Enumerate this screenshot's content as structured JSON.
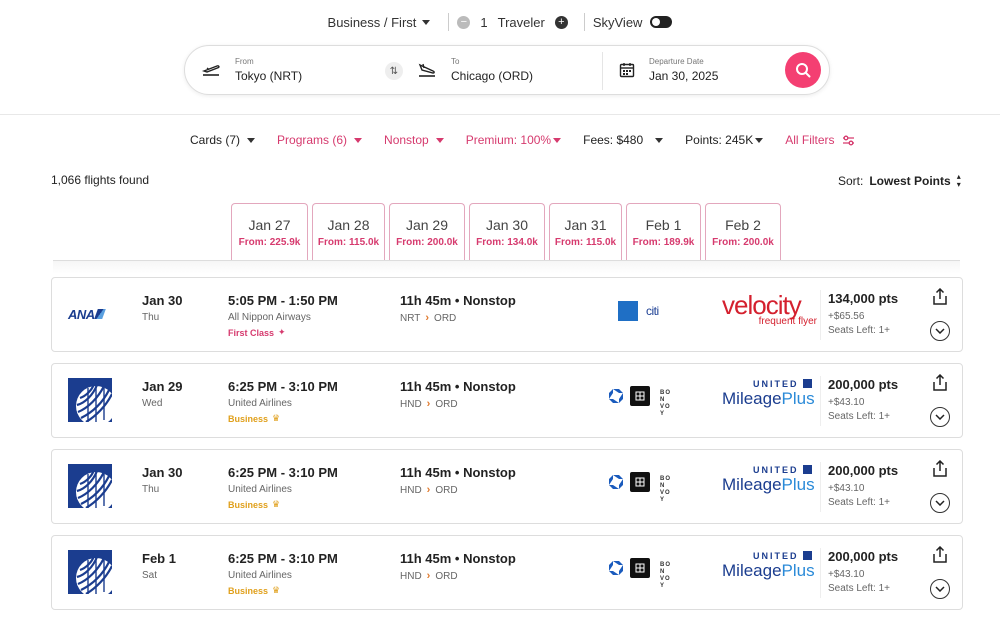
{
  "topbar": {
    "cabin": "Business / First",
    "travelers_count": "1",
    "travelers_label": "Traveler",
    "skyview_label": "SkyView"
  },
  "search": {
    "from_label": "From",
    "from_value": "Tokyo (NRT)",
    "to_label": "To",
    "to_value": "Chicago (ORD)",
    "date_label": "Departure Date",
    "date_value": "Jan 30, 2025"
  },
  "filters": [
    {
      "label": "Cards (7)",
      "style": "dark"
    },
    {
      "label": "Programs (6)",
      "style": "pink"
    },
    {
      "label": "Nonstop",
      "style": "pink"
    },
    {
      "label": "Premium: 100%",
      "style": "pink"
    },
    {
      "label": "Fees: $480",
      "style": "dark"
    },
    {
      "label": "Points: 245K",
      "style": "dark"
    },
    {
      "label": "All Filters",
      "style": "pink"
    }
  ],
  "results": {
    "count": "1,066 flights found",
    "sort_label": "Sort:",
    "sort_value": "Lowest Points"
  },
  "date_tabs": [
    {
      "date": "Jan 27",
      "price": "From: 225.9k"
    },
    {
      "date": "Jan 28",
      "price": "From: 115.0k"
    },
    {
      "date": "Jan 29",
      "price": "From: 200.0k"
    },
    {
      "date": "Jan 30",
      "price": "From: 134.0k"
    },
    {
      "date": "Jan 31",
      "price": "From: 115.0k"
    },
    {
      "date": "Feb 1",
      "price": "From: 189.9k"
    },
    {
      "date": "Feb 2",
      "price": "From: 200.0k"
    }
  ],
  "flights": [
    {
      "date": "Jan 30",
      "dow": "Thu",
      "time": "5:05 PM - 1:50 PM",
      "airline": "All Nippon Airways",
      "cabin": "First Class",
      "duration": "11h 45m • Nonstop",
      "origin": "NRT",
      "destination": "ORD",
      "points": "134,000 pts",
      "fee": "+$65.56",
      "seats": "Seats Left: 1+",
      "airline_logo_text": "ANA",
      "program_text_1": "velocity",
      "program_text_2": "frequent flyer",
      "card_text": "citi"
    },
    {
      "date": "Jan 29",
      "dow": "Wed",
      "time": "6:25 PM - 3:10 PM",
      "airline": "United Airlines",
      "cabin": "Business",
      "duration": "11h 45m • Nonstop",
      "origin": "HND",
      "destination": "ORD",
      "points": "200,000 pts",
      "fee": "+$43.10",
      "seats": "Seats Left: 1+",
      "program_text_1": "UNITED",
      "program_text_2": "Mileage",
      "program_text_3": "Plus",
      "card_text": "BON VOY"
    },
    {
      "date": "Jan 30",
      "dow": "Thu",
      "time": "6:25 PM - 3:10 PM",
      "airline": "United Airlines",
      "cabin": "Business",
      "duration": "11h 45m • Nonstop",
      "origin": "HND",
      "destination": "ORD",
      "points": "200,000 pts",
      "fee": "+$43.10",
      "seats": "Seats Left: 1+",
      "program_text_1": "UNITED",
      "program_text_2": "Mileage",
      "program_text_3": "Plus",
      "card_text": "BON VOY"
    },
    {
      "date": "Feb 1",
      "dow": "Sat",
      "time": "6:25 PM - 3:10 PM",
      "airline": "United Airlines",
      "cabin": "Business",
      "duration": "11h 45m • Nonstop",
      "origin": "HND",
      "destination": "ORD",
      "points": "200,000 pts",
      "fee": "+$43.10",
      "seats": "Seats Left: 1+",
      "program_text_1": "UNITED",
      "program_text_2": "Mileage",
      "program_text_3": "Plus",
      "card_text": "BON VOY"
    }
  ],
  "colors": {
    "accent": "#f43f72",
    "pink_text": "#d63a6e",
    "business_gold": "#e0a01c",
    "united_blue": "#1b3d8f"
  }
}
